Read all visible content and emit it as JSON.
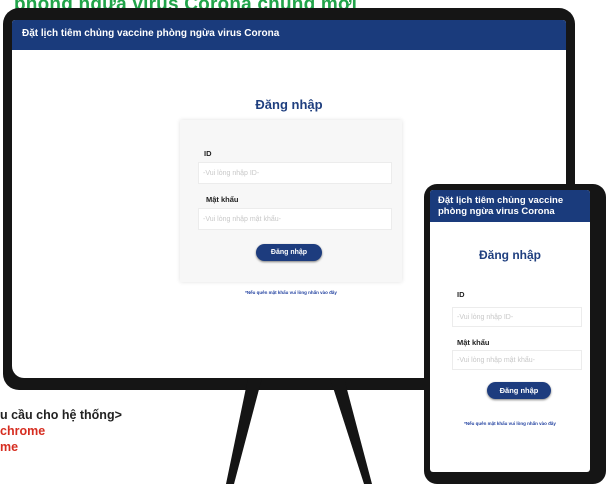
{
  "banner": {
    "text": "phòng ngừa virus Corona chủng mới"
  },
  "app": {
    "title": "Đặt lịch tiêm chủng vaccine phòng ngừa virus Corona"
  },
  "login": {
    "title": "Đăng nhập",
    "id_label": "ID",
    "id_placeholder": "-Vui lòng nhập ID-",
    "password_label": "Mật khẩu",
    "password_placeholder": "-Vui lòng nhập mật khẩu-",
    "submit_label": "Đăng nhập",
    "forgot_text": "*Nếu quên mật khẩu vui lòng nhấn vào đây"
  },
  "requirements": {
    "line1": "u cầu cho hệ thống>",
    "line2": "chrome",
    "line3": "me"
  },
  "colors": {
    "header": "#1a3b7c",
    "green": "#21a34a",
    "red": "#d62d20",
    "bezel": "#151515"
  }
}
